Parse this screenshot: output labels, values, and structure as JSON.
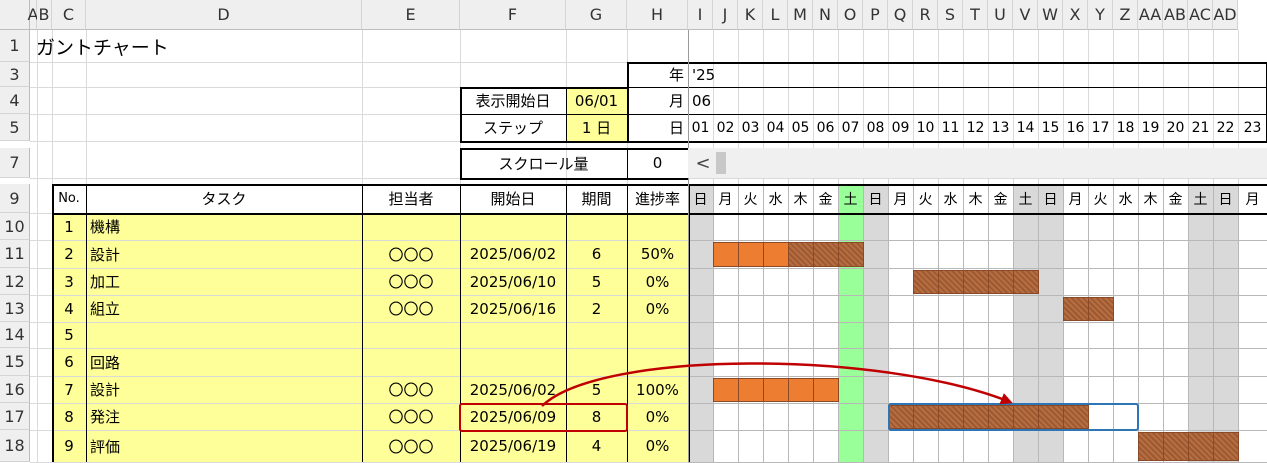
{
  "columns": [
    "A",
    "B",
    "C",
    "D",
    "E",
    "F",
    "G",
    "H",
    "I",
    "J",
    "K",
    "L",
    "M",
    "N",
    "O",
    "P",
    "Q",
    "R",
    "S",
    "T",
    "U",
    "V",
    "W",
    "X",
    "Y",
    "Z",
    "AA",
    "AB",
    "AC",
    "AD"
  ],
  "rows": [
    "1",
    "3",
    "4",
    "5",
    "7",
    "9",
    "10",
    "11",
    "12",
    "13",
    "14",
    "15",
    "16",
    "17",
    "18"
  ],
  "title": "ガントチャート",
  "header": {
    "year_label": "年",
    "year_value": "'25",
    "start_label": "表示開始日",
    "start_value": "06/01",
    "month_label": "月",
    "month_value": "06",
    "step_label": "ステップ",
    "step_value": "1 日",
    "day_label": "日",
    "scroll_label": "スクロール量",
    "scroll_value": "0",
    "scroll_arrow": "<"
  },
  "table_headers": {
    "no": "No.",
    "task": "タスク",
    "owner": "担当者",
    "start": "開始日",
    "duration": "期間",
    "progress": "進捗率"
  },
  "days": [
    "01",
    "02",
    "03",
    "04",
    "05",
    "06",
    "07",
    "08",
    "09",
    "10",
    "11",
    "12",
    "13",
    "14",
    "15",
    "16",
    "17",
    "18",
    "19",
    "20",
    "21",
    "22",
    "23"
  ],
  "weekdays": [
    "日",
    "月",
    "火",
    "水",
    "木",
    "金",
    "土",
    "日",
    "月",
    "火",
    "水",
    "木",
    "金",
    "土",
    "日",
    "月",
    "火",
    "水",
    "木",
    "金",
    "土",
    "日",
    "月"
  ],
  "tasks": [
    {
      "no": "1",
      "name": "機構",
      "owner": "",
      "start": "",
      "duration": "",
      "progress": ""
    },
    {
      "no": "2",
      "name": "設計",
      "owner": "〇〇〇",
      "start": "2025/06/02",
      "duration": "6",
      "progress": "50%"
    },
    {
      "no": "3",
      "name": "加工",
      "owner": "〇〇〇",
      "start": "2025/06/10",
      "duration": "5",
      "progress": "0%"
    },
    {
      "no": "4",
      "name": "組立",
      "owner": "〇〇〇",
      "start": "2025/06/16",
      "duration": "2",
      "progress": "0%"
    },
    {
      "no": "5",
      "name": "",
      "owner": "",
      "start": "",
      "duration": "",
      "progress": ""
    },
    {
      "no": "6",
      "name": "回路",
      "owner": "",
      "start": "",
      "duration": "",
      "progress": ""
    },
    {
      "no": "7",
      "name": "設計",
      "owner": "〇〇〇",
      "start": "2025/06/02",
      "duration": "5",
      "progress": "100%"
    },
    {
      "no": "8",
      "name": "発注",
      "owner": "〇〇〇",
      "start": "2025/06/09",
      "duration": "8",
      "progress": "0%"
    },
    {
      "no": "9",
      "name": "評価",
      "owner": "〇〇〇",
      "start": "2025/06/19",
      "duration": "4",
      "progress": "0%"
    }
  ],
  "colors": {
    "yellow": "#ffff99",
    "orange": "#ed7d31",
    "brown": "#a0522d",
    "weekend": "#d9d9d9",
    "today": "#99ff99",
    "red": "#c00000",
    "blue": "#2e75b6"
  }
}
